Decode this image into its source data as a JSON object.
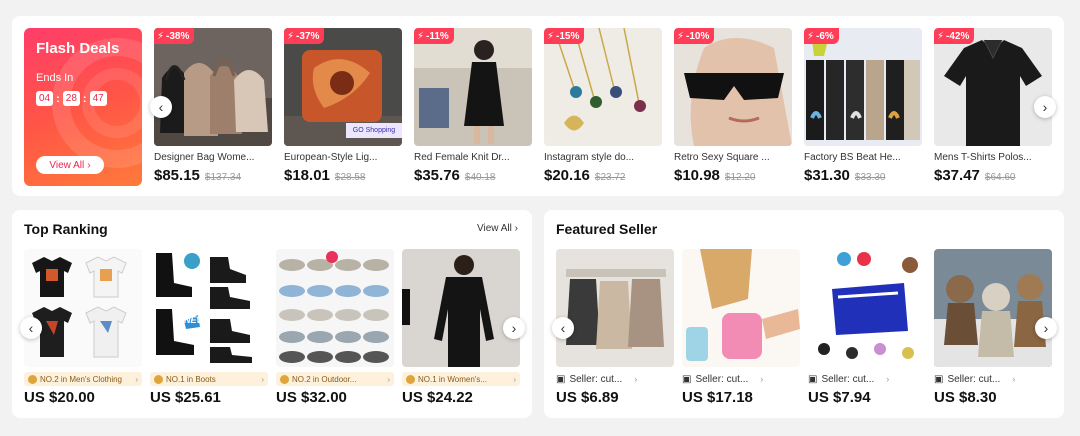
{
  "flash": {
    "title": "Flash Deals",
    "ends_label": "Ends In",
    "timer": {
      "h": "04",
      "m": "28",
      "s": "47"
    },
    "view_all": "View All",
    "items": [
      {
        "discount": "-38%",
        "name": "Designer Bag Wome...",
        "price": "$85.15",
        "old": "$137.34"
      },
      {
        "discount": "-37%",
        "name": "European-Style Lig...",
        "price": "$18.01",
        "old": "$28.58",
        "overlay": "GO Shopping"
      },
      {
        "discount": "-11%",
        "name": "Red Female Knit Dr...",
        "price": "$35.76",
        "old": "$40.18"
      },
      {
        "discount": "-15%",
        "name": "Instagram style do...",
        "price": "$20.16",
        "old": "$23.72"
      },
      {
        "discount": "-10%",
        "name": "Retro Sexy Square ...",
        "price": "$10.98",
        "old": "$12.20"
      },
      {
        "discount": "-6%",
        "name": "Factory BS Beat He...",
        "price": "$31.30",
        "old": "$33.30"
      },
      {
        "discount": "-42%",
        "name": "Mens T-Shirts Polos...",
        "price": "$37.47",
        "old": "$64.60"
      }
    ]
  },
  "ranking": {
    "title": "Top Ranking",
    "view_all": "View All",
    "items": [
      {
        "tag": "NO.2 in Men's Clothing",
        "price": "US $20.00"
      },
      {
        "tag": "NO.1 in Boots",
        "price": "US $25.61",
        "overlay": "NEW"
      },
      {
        "tag": "NO.2 in Outdoor...",
        "price": "US $32.00"
      },
      {
        "tag": "NO.1 in Women's...",
        "price": "US $24.22"
      }
    ]
  },
  "featured": {
    "title": "Featured Seller",
    "items": [
      {
        "seller": "Seller: cut...",
        "price": "US $6.89"
      },
      {
        "seller": "Seller: cut...",
        "price": "US $17.18"
      },
      {
        "seller": "Seller: cut...",
        "price": "US $7.94"
      },
      {
        "seller": "Seller: cut...",
        "price": "US $8.30"
      }
    ]
  },
  "colors": {
    "accent": "#ff3d57",
    "promo_from": "#ff3d6a",
    "promo_to": "#ff7a3a",
    "tag_bg": "#fdf1dc"
  }
}
